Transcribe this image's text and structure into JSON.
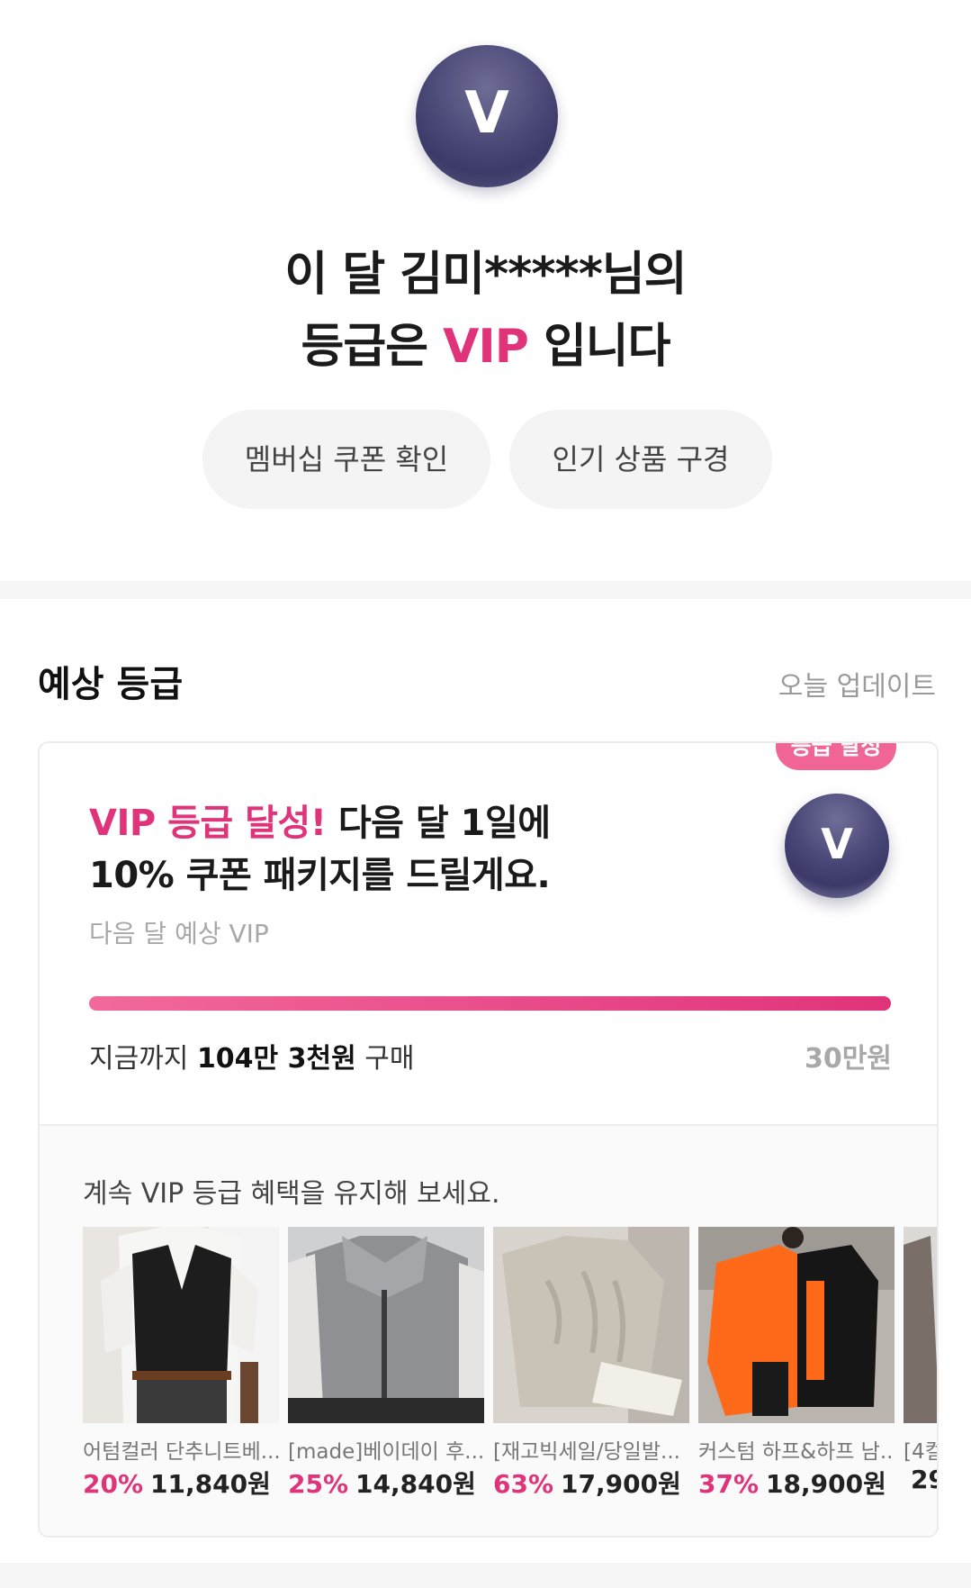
{
  "header": {
    "avatar_letter": "V",
    "line1": "이 달 김미*****님의",
    "line2_prefix": "등급은 ",
    "grade": "VIP",
    "line2_suffix": " 입니다",
    "buttons": {
      "coupon": "멤버십 쿠폰 확인",
      "popular": "인기 상품 구경"
    }
  },
  "section": {
    "title": "예상 등급",
    "update": "오늘 업데이트"
  },
  "achievement": {
    "badge": "등급 달성",
    "avatar_letter": "V",
    "highlight": "VIP 등급 달성!",
    "line1_rest": " 다음 달 1일에",
    "line2": "10% 쿠폰 패키지를 드릴게요.",
    "sub": "다음 달 예상 VIP",
    "progress_fraction": 1.0,
    "spent_prefix": "지금까지 ",
    "spent_amount": "104만 3천원",
    "spent_suffix": " 구매",
    "target": "30만원"
  },
  "recommend": {
    "title": "계속 VIP 등급 혜택을 유지해 보세요.",
    "products": [
      {
        "name": "어텀컬러 단추니트베...",
        "discount": "20%",
        "price": "11,840원"
      },
      {
        "name": "[made]베이데이 후...",
        "discount": "25%",
        "price": "14,840원"
      },
      {
        "name": "[재고빅세일/당일발...",
        "discount": "63%",
        "price": "17,900원"
      },
      {
        "name": "커스텀 하프&하프 남...",
        "discount": "37%",
        "price": "18,900원"
      },
      {
        "name": "[4컬",
        "discount": "",
        "price": "29"
      }
    ]
  },
  "colors": {
    "accent": "#e0337a",
    "badge": "#f06496",
    "avatar": "#4a4878"
  }
}
